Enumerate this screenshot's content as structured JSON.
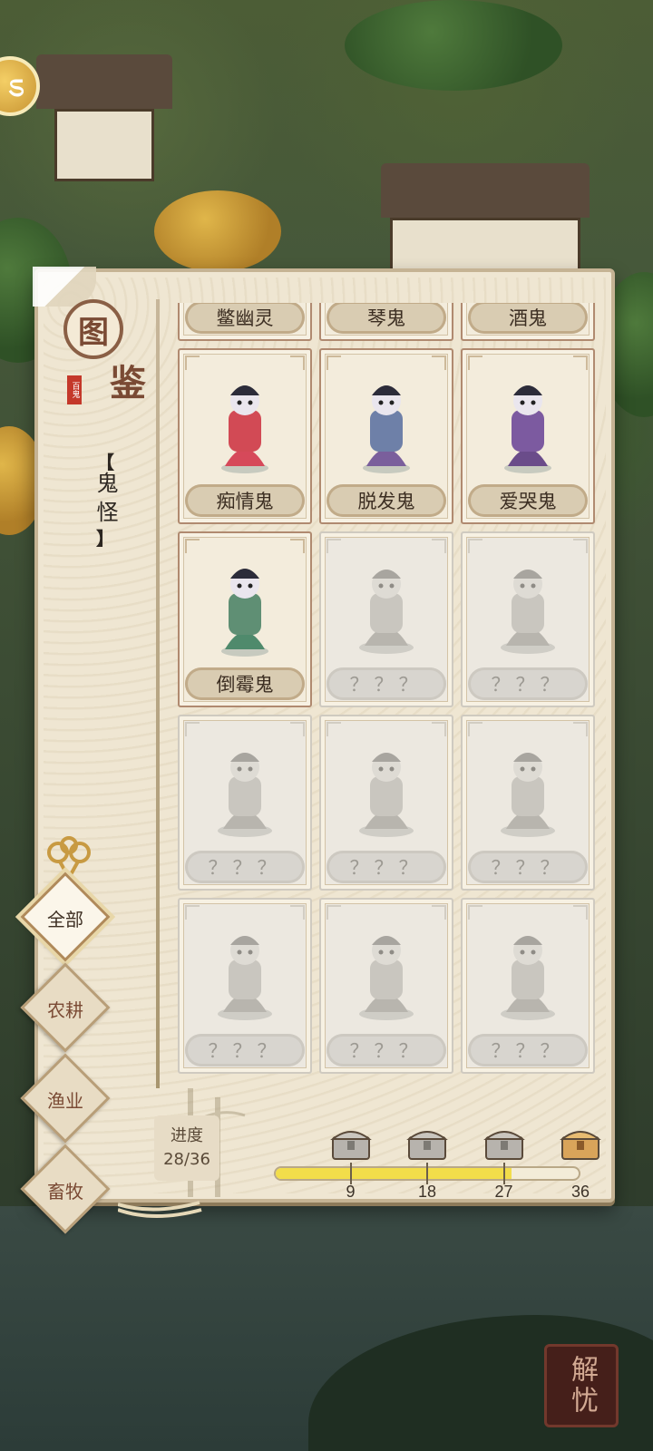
{
  "hud": {
    "quest_icon": "swirl-coin-icon",
    "seal_text": "解忧"
  },
  "panel": {
    "logo_top": "图",
    "logo_bottom": "鉴",
    "logo_stamp": "百鬼",
    "category": {
      "open_bracket": "【",
      "name": "鬼怪",
      "close_bracket": "】"
    }
  },
  "collection": {
    "cards": [
      {
        "name": "鳖幽灵",
        "found": true,
        "icon": "ghost-icon"
      },
      {
        "name": "琴鬼",
        "found": true,
        "icon": "ghost-icon"
      },
      {
        "name": "酒鬼",
        "found": true,
        "icon": "ghost-icon"
      },
      {
        "name": "痴情鬼",
        "found": true,
        "icon": "umbrella-ghost-icon"
      },
      {
        "name": "脱发鬼",
        "found": true,
        "icon": "book-ghost-icon"
      },
      {
        "name": "爱哭鬼",
        "found": true,
        "icon": "crying-ghost-icon"
      },
      {
        "name": "倒霉鬼",
        "found": true,
        "icon": "unlucky-ghost-icon"
      },
      {
        "name": "？？？",
        "found": false,
        "icon": "hooded-ghost-icon"
      },
      {
        "name": "？？？",
        "found": false,
        "icon": "maiden-ghost-icon"
      },
      {
        "name": "？？？",
        "found": false,
        "icon": "bearded-ghost-icon"
      },
      {
        "name": "？？？",
        "found": false,
        "icon": "hat-ghost-icon"
      },
      {
        "name": "？？？",
        "found": false,
        "icon": "fairy-ghost-icon"
      },
      {
        "name": "？？？",
        "found": false,
        "icon": "rabbit-ghost-icon"
      },
      {
        "name": "？？？",
        "found": false,
        "icon": "dragon-rider-icon"
      },
      {
        "name": "？？？",
        "found": false,
        "icon": "official-ghost-icon"
      }
    ]
  },
  "tabs": [
    {
      "label": "全部",
      "active": true
    },
    {
      "label": "农耕",
      "active": false
    },
    {
      "label": "渔业",
      "active": false
    },
    {
      "label": "畜牧",
      "active": false
    }
  ],
  "progress": {
    "label": "进度",
    "text": "28/36",
    "current": 28,
    "total": 36,
    "milestones": [
      {
        "value": "9",
        "icon": "silver-chest-icon"
      },
      {
        "value": "18",
        "icon": "silver-chest-icon"
      },
      {
        "value": "27",
        "icon": "silver-chest-icon"
      },
      {
        "value": "36",
        "icon": "gold-chest-icon"
      }
    ]
  },
  "colors": {
    "bar_fill": "#f2dd4a",
    "accent_brown": "#7a4a34"
  }
}
